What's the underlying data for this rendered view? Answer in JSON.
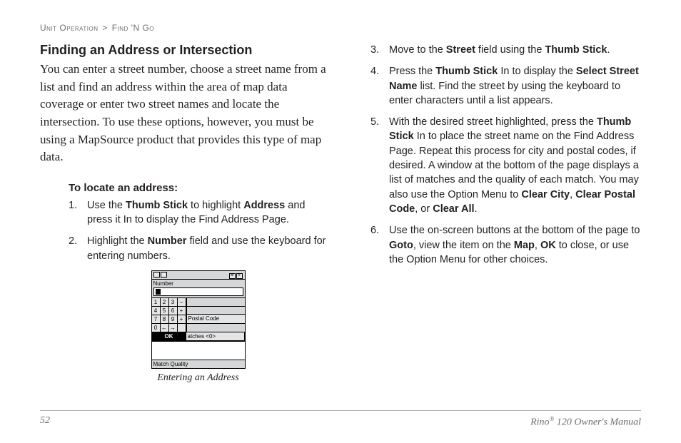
{
  "breadcrumb": {
    "a": "Unit Operation",
    "sep": ">",
    "b": "Find 'N Go"
  },
  "left": {
    "title": "Finding an Address or Intersection",
    "intro": "You can enter a street number, choose a street name from a list and find an address within the area of map data coverage or enter two street names and locate the intersection. To use these options, however, you must be using a MapSource product that provides this type of map data.",
    "sub_head": "To locate an address:",
    "steps": [
      {
        "n": "1.",
        "pre": "Use the ",
        "b1": "Thumb Stick",
        "mid": " to highlight ",
        "b2": "Address",
        "post": " and press it In to display the Find Address Page."
      },
      {
        "n": "2.",
        "pre": "Highlight the ",
        "b1": "Number",
        "post": " field and use the keyboard for entering numbers."
      }
    ],
    "figure": {
      "top_label": "Number",
      "keypad": [
        "1",
        "2",
        "3",
        "–",
        "4",
        "5",
        "6",
        "+",
        "7",
        "8",
        "9",
        "+",
        "0",
        "←",
        "→",
        " "
      ],
      "side_rows": [
        "",
        "",
        "Postal Code",
        ""
      ],
      "ok": "OK",
      "matches": "atches <0>",
      "footer": "Match Quality",
      "caption": "Entering an Address"
    }
  },
  "right": {
    "steps": [
      {
        "n": "3.",
        "pre": "Move to the ",
        "b1": "Street",
        "mid": " field using the ",
        "b2": "Thumb Stick",
        "post": "."
      },
      {
        "n": "4.",
        "pre": "Press the ",
        "b1": "Thumb Stick",
        "mid": " In to display the ",
        "b2": "Select Street Name",
        "post": " list. Find the street by using the keyboard to enter characters until a list appears."
      },
      {
        "n": "5.",
        "pre": "With the desired street highlighted, press the ",
        "b1": "Thumb Stick",
        "mid": " In to place the street name on the Find Address Page. Repeat this process for city and postal codes, if desired. A window at the bottom of the page displays a list of matches and the quality of each match. You may also use the Option Menu to ",
        "b2": "Clear City",
        "mid2": ", ",
        "b3": "Clear Postal Code",
        "mid3": ", or ",
        "b4": "Clear All",
        "post": "."
      },
      {
        "n": "6.",
        "pre": "Use the on-screen buttons at the bottom of the page to ",
        "b1": "Goto",
        "mid": ", view the item on the ",
        "b2": "Map",
        "mid2": ", ",
        "b3": "OK",
        "post": " to close, or use the Option Menu for other choices."
      }
    ]
  },
  "footer": {
    "page": "52",
    "product_a": "Rino",
    "reg": "®",
    "product_b": " 120 Owner's Manual"
  }
}
